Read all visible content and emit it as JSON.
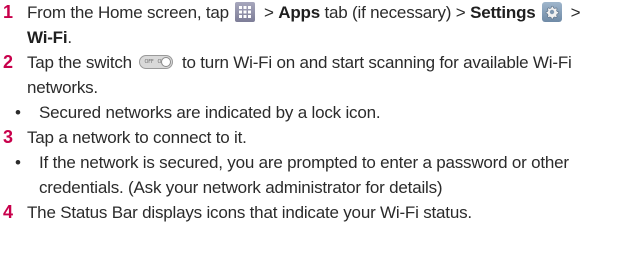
{
  "steps": [
    {
      "number": "1",
      "line1_pre": "From the Home screen, tap",
      "line1_gt1": ">",
      "apps_tab": "Apps",
      "line1_mid": "tab (if necessary) >",
      "settings": "Settings",
      "line1_gt2": ">",
      "wifi": "Wi-Fi",
      "line1_end": "."
    },
    {
      "number": "2",
      "pre": "Tap the switch",
      "switch_off": "OFF",
      "switch_on": "ON",
      "post": "to turn Wi-Fi on and start scanning for available Wi-Fi networks.",
      "sub": "Secured networks are indicated by a lock icon."
    },
    {
      "number": "3",
      "text": "Tap a network to connect to it.",
      "sub": "If the network is secured, you are prompted to enter a password or other credentials. (Ask your network administrator for details)"
    },
    {
      "number": "4",
      "text": "The Status Bar displays icons that indicate your Wi-Fi status."
    }
  ],
  "bullet": "•",
  "icons": {
    "apps": "apps-grid-icon",
    "settings": "settings-gear-icon",
    "switch": "toggle-switch-icon"
  },
  "colors": {
    "step_number": "#c8004b",
    "text": "#2b2b2b"
  }
}
